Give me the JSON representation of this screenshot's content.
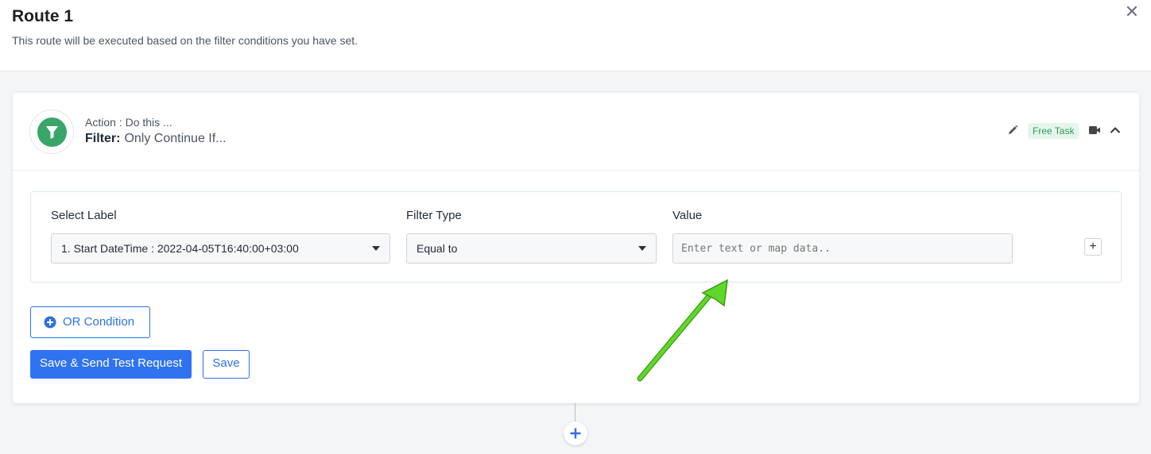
{
  "header": {
    "title": "Route 1",
    "subtitle": "This route will be executed based on the filter conditions you have set.",
    "close_icon": "close-icon"
  },
  "step": {
    "action_label": "Action : Do this ...",
    "filter_label": "Filter:",
    "filter_sub": "Only Continue If...",
    "icon": "filter-icon",
    "badge": "Free Task",
    "tools": [
      "pencil-icon",
      "video-icon",
      "chevron-up-icon"
    ]
  },
  "condition": {
    "select_label_heading": "Select Label",
    "select_label_value": "1. Start DateTime : 2022-04-05T16:40:00+03:00",
    "filter_type_heading": "Filter Type",
    "filter_type_value": "Equal to",
    "value_heading": "Value",
    "value_placeholder": "Enter text or map data..",
    "value_current": ""
  },
  "buttons": {
    "or_condition": "OR Condition",
    "save_send": "Save & Send Test Request",
    "save": "Save"
  },
  "colors": {
    "accent": "#2f73f0",
    "filter_icon_bg": "#3aa569",
    "badge_bg": "#e6f6ec",
    "badge_text": "#2f9a5a",
    "annotation_arrow": "#5fd82a"
  }
}
